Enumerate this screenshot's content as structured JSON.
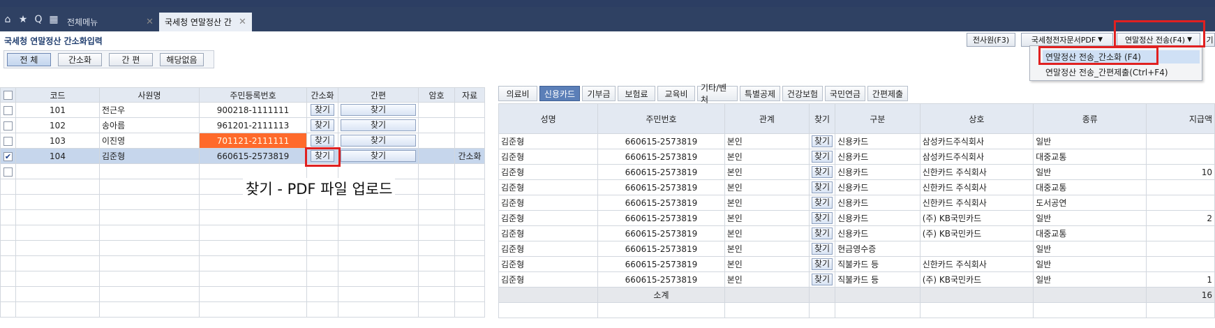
{
  "tabs": {
    "all_menu": "전체메뉴",
    "active": "국세청 연말정산 간"
  },
  "page_title": "국세청 연말정산 간소화입력",
  "toolbar": {
    "previous": "전사원(F3)",
    "pdf": "국세청전자문서PDF",
    "send": "연말정산 전송(F4)",
    "extra": "기"
  },
  "dropdown": {
    "items": [
      "연말정산 전송_간소화 (F4)",
      "연말정산 전송_간편제출(Ctrl+F4)"
    ]
  },
  "filters": [
    "전 체",
    "간소화",
    "간 편",
    "해당없음"
  ],
  "left_table": {
    "headers": [
      "코드",
      "사원명",
      "주민등록번호",
      "간소화",
      "간편",
      "암호",
      "자료"
    ],
    "find_label": "찾기",
    "rows": [
      {
        "code": "101",
        "name": "전근우",
        "rrn": "900218-1111111",
        "data": ""
      },
      {
        "code": "102",
        "name": "송아름",
        "rrn": "961201-2111113",
        "data": ""
      },
      {
        "code": "103",
        "name": "이진영",
        "rrn": "701121-2111111",
        "data": ""
      },
      {
        "code": "104",
        "name": "김준형",
        "rrn": "660615-2573819",
        "data": "간소화"
      }
    ]
  },
  "note": "찾기 - PDF 파일 업로드",
  "right_tabs": [
    "의료비",
    "신용카드",
    "기부금",
    "보험료",
    "교육비",
    "기타/벤처",
    "특별공제",
    "건강보험",
    "국민연금",
    "간편제출"
  ],
  "right_table": {
    "headers": [
      "성명",
      "주민번호",
      "관계",
      "찾기",
      "구분",
      "상호",
      "종류",
      "지급액"
    ],
    "find_label": "찾기",
    "rows": [
      {
        "name": "김준형",
        "rrn": "660615-2573819",
        "rel": "본인",
        "type": "신용카드",
        "shop": "삼성카드주식회사",
        "kind": "일반",
        "amount": ""
      },
      {
        "name": "김준형",
        "rrn": "660615-2573819",
        "rel": "본인",
        "type": "신용카드",
        "shop": "삼성카드주식회사",
        "kind": "대중교통",
        "amount": ""
      },
      {
        "name": "김준형",
        "rrn": "660615-2573819",
        "rel": "본인",
        "type": "신용카드",
        "shop": "신한카드 주식회사",
        "kind": "일반",
        "amount": "10"
      },
      {
        "name": "김준형",
        "rrn": "660615-2573819",
        "rel": "본인",
        "type": "신용카드",
        "shop": "신한카드 주식회사",
        "kind": "대중교통",
        "amount": ""
      },
      {
        "name": "김준형",
        "rrn": "660615-2573819",
        "rel": "본인",
        "type": "신용카드",
        "shop": "신한카드 주식회사",
        "kind": "도서공연",
        "amount": ""
      },
      {
        "name": "김준형",
        "rrn": "660615-2573819",
        "rel": "본인",
        "type": "신용카드",
        "shop": "(주) KB국민카드",
        "kind": "일반",
        "amount": "2"
      },
      {
        "name": "김준형",
        "rrn": "660615-2573819",
        "rel": "본인",
        "type": "신용카드",
        "shop": "(주) KB국민카드",
        "kind": "대중교통",
        "amount": ""
      },
      {
        "name": "김준형",
        "rrn": "660615-2573819",
        "rel": "본인",
        "type": "현금영수증",
        "shop": "",
        "kind": "일반",
        "amount": ""
      },
      {
        "name": "김준형",
        "rrn": "660615-2573819",
        "rel": "본인",
        "type": "직불카드 등",
        "shop": "신한카드 주식회사",
        "kind": "일반",
        "amount": ""
      },
      {
        "name": "김준형",
        "rrn": "660615-2573819",
        "rel": "본인",
        "type": "직불카드 등",
        "shop": "(주) KB국민카드",
        "kind": "일반",
        "amount": "1"
      }
    ],
    "subtotal_label": "소계",
    "subtotal_amount": "16"
  }
}
